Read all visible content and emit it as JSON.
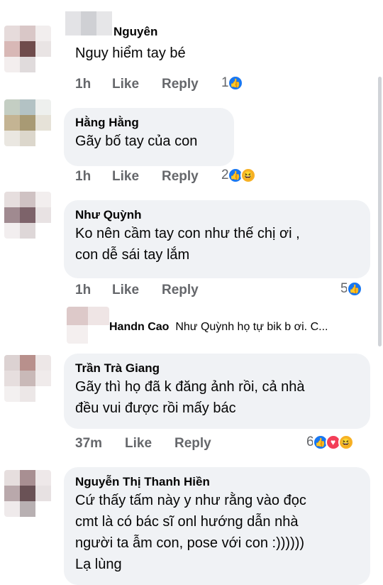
{
  "comments": [
    {
      "name": "Nguyên",
      "lines": [
        "Nguy hiểm tay bé"
      ],
      "time": "1h",
      "like": "Like",
      "reply": "Reply",
      "reactions": "1",
      "icons": [
        "like-icon"
      ]
    },
    {
      "name": "Hằng Hằng",
      "lines": [
        "Gãy bố tay của con"
      ],
      "time": "1h",
      "like": "Like",
      "reply": "Reply",
      "reactions": "2",
      "icons": [
        "like-icon",
        "haha-icon"
      ]
    },
    {
      "name": "Như Quỳnh",
      "lines": [
        "Ko nên cầm tay con như thế chị ơi ,",
        "con dễ sái tay lắm"
      ],
      "time": "1h",
      "like": "Like",
      "reply": "Reply",
      "reactions": "5",
      "icons": [
        "like-icon"
      ]
    },
    {
      "name": "Trần Trà Giang",
      "lines": [
        "Gãy thì họ đã k đăng ảnh rồi, cả nhà",
        "đều vui được rồi mấy bác"
      ],
      "time": "37m",
      "like": "Like",
      "reply": "Reply",
      "reactions": "6",
      "icons": [
        "like-icon",
        "love-icon",
        "haha-icon"
      ]
    },
    {
      "name": "Nguyễn Thị Thanh Hiền",
      "lines": [
        "Cứ thấy tấm này y như rằng vào đọc",
        "cmt là có bác sĩ onl hướng dẫn nhà",
        "người ta ẫm con, pose với con :))))))",
        "Lạ lùng"
      ]
    }
  ],
  "nested_reply": {
    "name": "Handn Cao",
    "text": "Như Quỳnh  họ tự bik b ơi. C..."
  },
  "colors": {
    "bubble": "#f0f2f5",
    "meta": "#65676b",
    "like_blue": "#1877f2",
    "love_red": "#f33e58",
    "haha_yellow": "#f7b125"
  }
}
